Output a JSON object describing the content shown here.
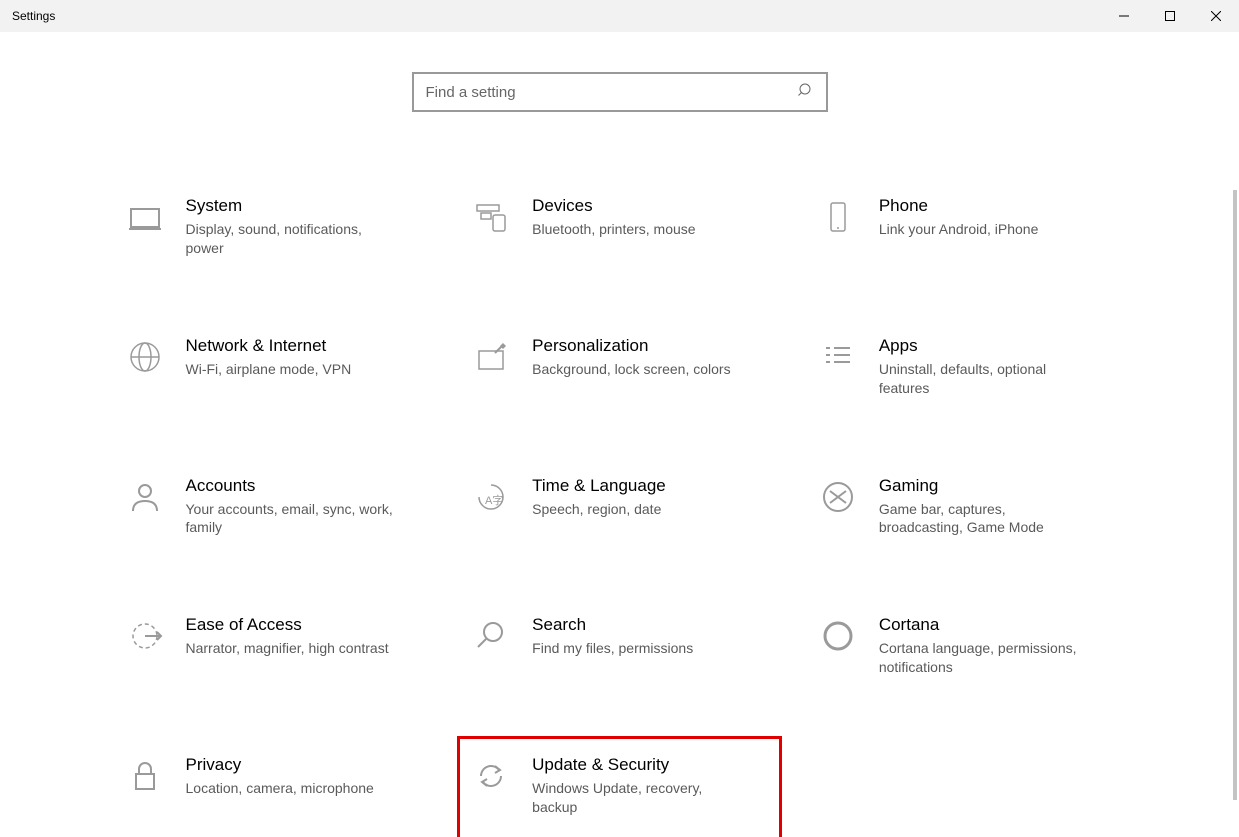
{
  "window": {
    "title": "Settings"
  },
  "search": {
    "placeholder": "Find a setting"
  },
  "tiles": [
    {
      "title": "System",
      "desc": "Display, sound, notifications, power",
      "icon": "system",
      "hl": false
    },
    {
      "title": "Devices",
      "desc": "Bluetooth, printers, mouse",
      "icon": "devices",
      "hl": false
    },
    {
      "title": "Phone",
      "desc": "Link your Android, iPhone",
      "icon": "phone",
      "hl": false
    },
    {
      "title": "Network & Internet",
      "desc": "Wi-Fi, airplane mode, VPN",
      "icon": "network",
      "hl": false
    },
    {
      "title": "Personalization",
      "desc": "Background, lock screen, colors",
      "icon": "personalization",
      "hl": false
    },
    {
      "title": "Apps",
      "desc": "Uninstall, defaults, optional features",
      "icon": "apps",
      "hl": false
    },
    {
      "title": "Accounts",
      "desc": "Your accounts, email, sync, work, family",
      "icon": "accounts",
      "hl": false
    },
    {
      "title": "Time & Language",
      "desc": "Speech, region, date",
      "icon": "time",
      "hl": false
    },
    {
      "title": "Gaming",
      "desc": "Game bar, captures, broadcasting, Game Mode",
      "icon": "gaming",
      "hl": false
    },
    {
      "title": "Ease of Access",
      "desc": "Narrator, magnifier, high contrast",
      "icon": "ease",
      "hl": false
    },
    {
      "title": "Search",
      "desc": "Find my files, permissions",
      "icon": "search",
      "hl": false
    },
    {
      "title": "Cortana",
      "desc": "Cortana language, permissions, notifications",
      "icon": "cortana",
      "hl": false
    },
    {
      "title": "Privacy",
      "desc": "Location, camera, microphone",
      "icon": "privacy",
      "hl": false
    },
    {
      "title": "Update & Security",
      "desc": "Windows Update, recovery, backup",
      "icon": "update",
      "hl": true
    }
  ]
}
